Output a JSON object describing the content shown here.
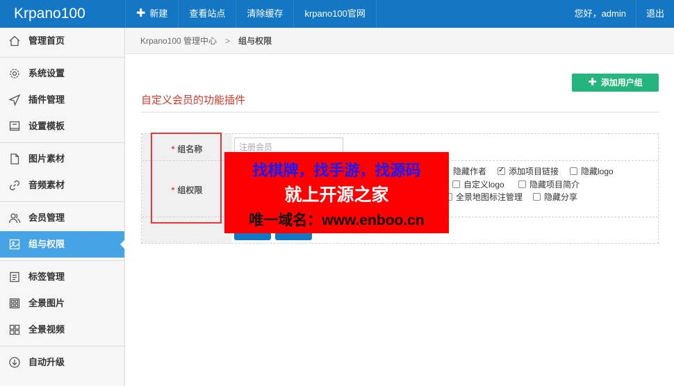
{
  "header": {
    "logo": "Krpano100",
    "nav": [
      {
        "label": "新建",
        "icon": "plus-icon"
      },
      {
        "label": "查看站点"
      },
      {
        "label": "清除缓存"
      },
      {
        "label": "krpano100官网"
      }
    ],
    "greeting": "您好，admin",
    "logout": "退出"
  },
  "sidebar": {
    "items": [
      {
        "label": "管理首页",
        "icon": "home-icon"
      },
      {
        "label": "系统设置",
        "icon": "gear-icon"
      },
      {
        "label": "插件管理",
        "icon": "send-icon"
      },
      {
        "label": "设置模板",
        "icon": "book-icon"
      },
      {
        "label": "图片素材",
        "icon": "file-icon"
      },
      {
        "label": "音频素材",
        "icon": "link-icon"
      },
      {
        "label": "会员管理",
        "icon": "users-icon"
      },
      {
        "label": "组与权限",
        "icon": "image-icon",
        "active": true
      },
      {
        "label": "标签管理",
        "icon": "document-icon"
      },
      {
        "label": "全景图片",
        "icon": "grid-icon"
      },
      {
        "label": "全景视频",
        "icon": "apps-icon"
      },
      {
        "label": "自动升级",
        "icon": "download-icon"
      }
    ]
  },
  "breadcrumb": {
    "root": "Krpano100 管理中心",
    "separator": ">",
    "current": "组与权限"
  },
  "main": {
    "add_button": "添加用户组",
    "section_title": "自定义会员的功能插件",
    "form": {
      "required_mark": "*",
      "group_name_label": "组名称",
      "group_name_placeholder": "注册会员",
      "permissions_label": "组权限",
      "permissions": [
        {
          "label": "隐藏作者",
          "checked": false,
          "box_visible": false
        },
        {
          "label": "添加项目链接",
          "checked": true
        },
        {
          "label": "隐藏logo",
          "checked": false
        },
        {
          "label": "自定义logo",
          "checked": false
        },
        {
          "label": "隐藏项目简介",
          "checked": false
        },
        {
          "label": "全景地图标注管理",
          "checked": false
        },
        {
          "label": "隐藏分享",
          "checked": false
        }
      ]
    }
  },
  "watermark": {
    "line1": "找棋牌，找手游，找源码",
    "line2": "就上开源之家",
    "line3": "唯一域名：www.enboo.cn"
  },
  "colors": {
    "topbar": "#1377c5",
    "sidebar_active": "#45a3e6",
    "add_button": "#24b47e",
    "section_title": "#d33b2c",
    "overlay": "#ff0000"
  }
}
